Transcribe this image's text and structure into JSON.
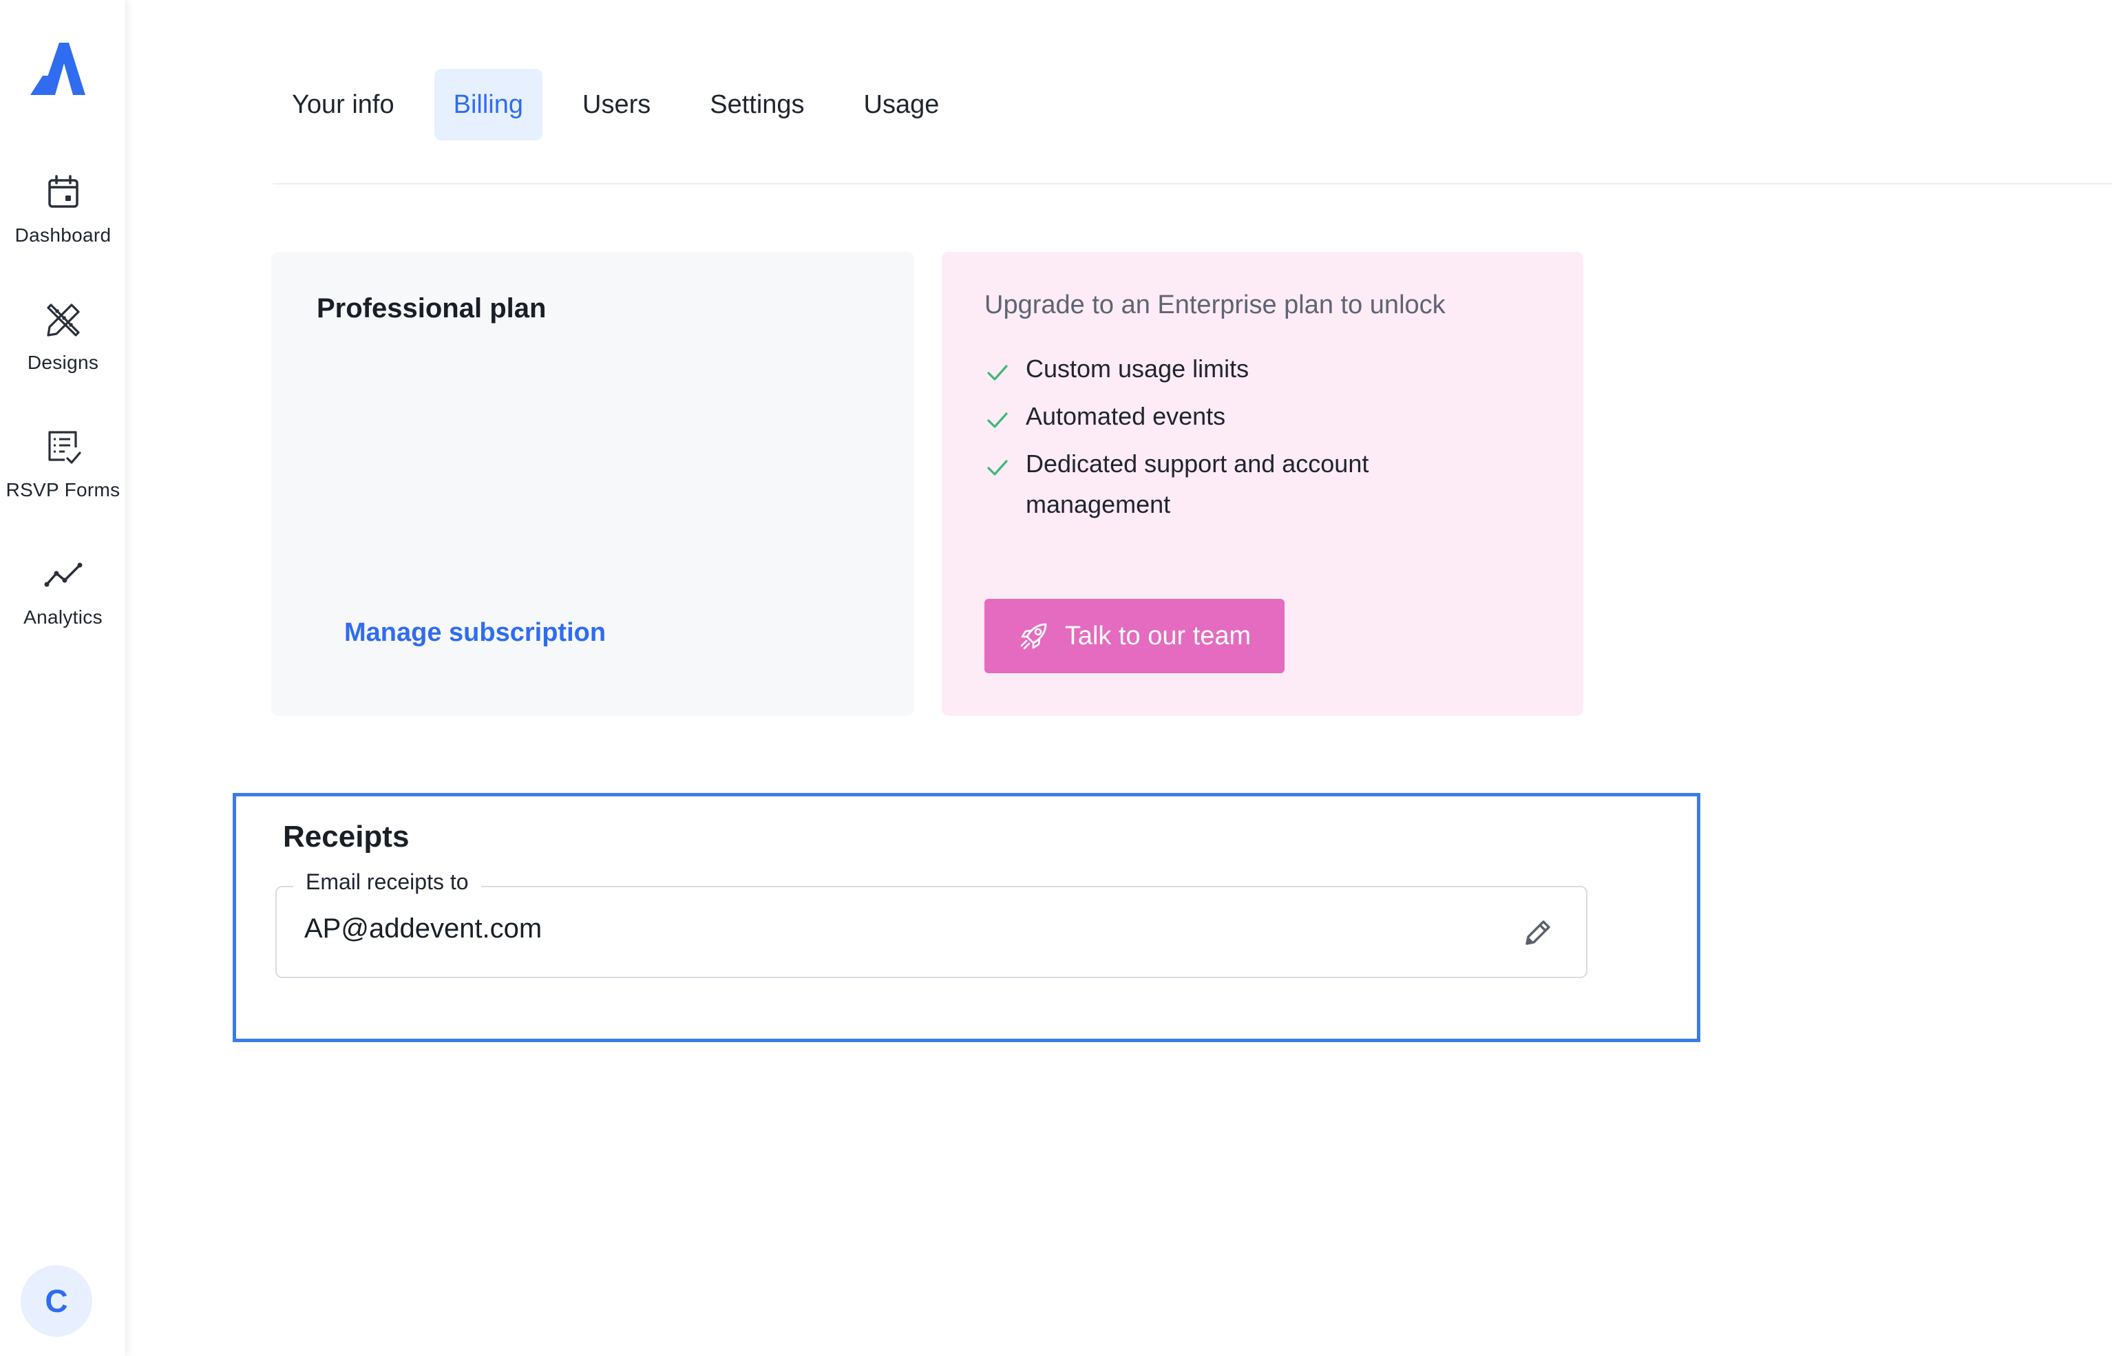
{
  "sidebar": {
    "logo_icon": "addevent-logo-icon",
    "items": [
      {
        "label": "Dashboard",
        "icon": "calendar-icon"
      },
      {
        "label": "Designs",
        "icon": "pencil-ruler-icon"
      },
      {
        "label": "RSVP Forms",
        "icon": "form-check-icon"
      },
      {
        "label": "Analytics",
        "icon": "line-chart-icon"
      }
    ],
    "avatar_letter": "C"
  },
  "tabs": [
    {
      "label": "Your info",
      "active": false
    },
    {
      "label": "Billing",
      "active": true
    },
    {
      "label": "Users",
      "active": false
    },
    {
      "label": "Settings",
      "active": false
    },
    {
      "label": "Usage",
      "active": false
    }
  ],
  "plan": {
    "title": "Professional plan",
    "manage_label": "Manage subscription"
  },
  "upgrade": {
    "heading": "Upgrade to an Enterprise plan to unlock",
    "features": [
      "Custom usage limits",
      "Automated events",
      "Dedicated support and account management"
    ],
    "button_label": "Talk to our team",
    "button_icon": "rocket-icon"
  },
  "receipts": {
    "title": "Receipts",
    "field_label": "Email receipts to",
    "email": "AP@addevent.com",
    "edit_icon": "pencil-icon"
  },
  "colors": {
    "accent": "#2f6cf0",
    "tab_active_bg": "#e7f0ff",
    "plan_bg": "#f7f8fa",
    "upgrade_bg": "#fdebf6",
    "cta": "#e46bbf",
    "check": "#3db87a",
    "highlight_border": "#3a7be8"
  }
}
